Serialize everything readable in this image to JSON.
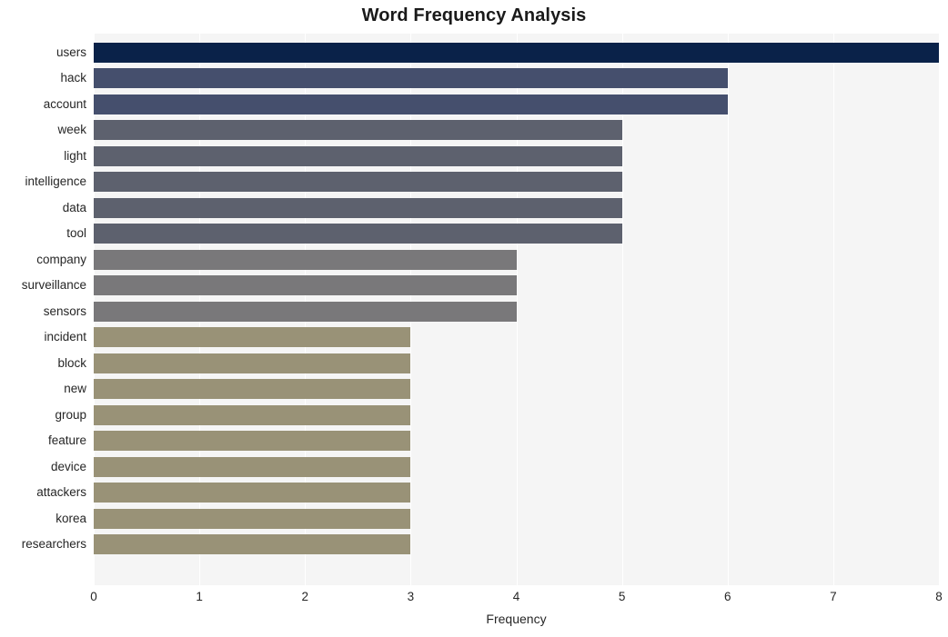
{
  "chart_data": {
    "type": "bar",
    "orientation": "horizontal",
    "title": "Word Frequency Analysis",
    "xlabel": "Frequency",
    "ylabel": "",
    "xlim": [
      0,
      8
    ],
    "ylim": null,
    "grid": true,
    "legend": false,
    "legend_position": "none",
    "xticks": [
      "0",
      "1",
      "2",
      "3",
      "4",
      "5",
      "6",
      "7",
      "8"
    ],
    "xtick_values": [
      0,
      1,
      2,
      3,
      4,
      5,
      6,
      7,
      8
    ],
    "categories": [
      "users",
      "hack",
      "account",
      "week",
      "light",
      "intelligence",
      "data",
      "tool",
      "company",
      "surveillance",
      "sensors",
      "incident",
      "block",
      "new",
      "group",
      "feature",
      "device",
      "attackers",
      "korea",
      "researchers"
    ],
    "values": [
      8,
      6,
      6,
      5,
      5,
      5,
      5,
      5,
      4,
      4,
      4,
      3,
      3,
      3,
      3,
      3,
      3,
      3,
      3,
      3
    ],
    "bar_colors": [
      "#0a2249",
      "#454f6d",
      "#454f6d",
      "#5d616e",
      "#5d616e",
      "#5d616e",
      "#5d616e",
      "#5d616e",
      "#79787a",
      "#79787a",
      "#79787a",
      "#999277",
      "#999277",
      "#999277",
      "#999277",
      "#999277",
      "#999277",
      "#999277",
      "#999277",
      "#999277"
    ]
  },
  "style": {
    "plot_background": "#f5f5f5",
    "figure_background": "#ffffff",
    "gridline_color": "#ffffff",
    "text_color": "#262626"
  }
}
